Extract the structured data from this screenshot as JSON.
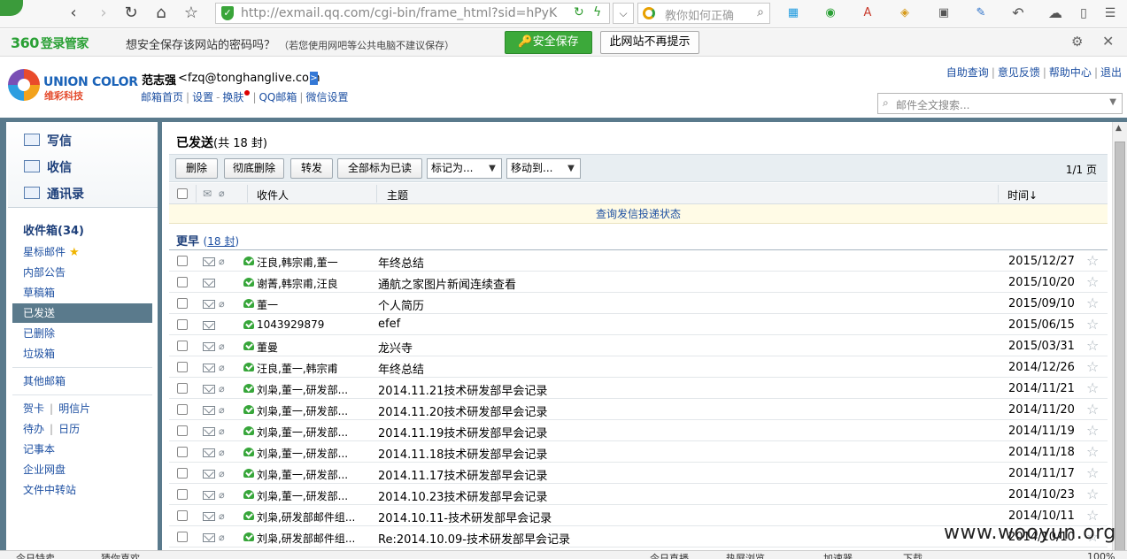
{
  "browser": {
    "url": "http://exmail.qq.com/cgi-bin/frame_html?sid=hPyK",
    "search_placeholder": "教你如何正确"
  },
  "password_bar": {
    "brand_360": "360",
    "brand_name": "登录管家",
    "message": "想安全保存该网站的密码吗？",
    "note": "（若您使用网吧等公共电脑不建议保存）",
    "save_label": "安全保存",
    "dont_ask_label": "此网站不再提示"
  },
  "header": {
    "logo_name": "UNION COLOR",
    "logo_sub": "维彩科技",
    "user_name": "范志强",
    "user_email": "<fzq@tonghanglive.com",
    "user_email_end": ">",
    "links": [
      "邮箱首页",
      "设置",
      "换肤",
      "QQ邮箱",
      "微信设置"
    ],
    "top_links": [
      "自助查询",
      "意见反馈",
      "帮助中心",
      "退出"
    ],
    "fulltext_placeholder": "邮件全文搜索..."
  },
  "sidebar": {
    "quick": [
      "写信",
      "收信",
      "通讯录"
    ],
    "folders": [
      {
        "label": "收件箱(34)",
        "bold": true
      },
      {
        "label": "星标邮件",
        "star": true
      },
      {
        "label": "内部公告"
      },
      {
        "label": "草稿箱"
      },
      {
        "label": "已发送",
        "selected": true
      },
      {
        "label": "已删除"
      },
      {
        "label": "垃圾箱"
      }
    ],
    "other": "其他邮箱",
    "tools": [
      {
        "a": "贺卡",
        "b": "明信片"
      },
      {
        "a": "待办",
        "b": "日历"
      }
    ],
    "extra": [
      "记事本",
      "企业网盘",
      "文件中转站"
    ]
  },
  "main": {
    "folder_title": "已发送",
    "folder_count": "(共 18 封)",
    "actions": [
      "删除",
      "彻底删除",
      "转发",
      "全部标为已读"
    ],
    "mark_as": "标记为...",
    "move_to": "移动到...",
    "pager": "1/1 页",
    "columns": {
      "to": "收件人",
      "subject": "主题",
      "time": "时间↓"
    },
    "track_link": "查询发信投递状态",
    "group_title": "更早",
    "group_count": "18 封",
    "rows": [
      {
        "to": "汪良,韩宗甫,董一",
        "subject": "年终总结",
        "date": "2015/12/27",
        "clip": true
      },
      {
        "to": "谢菁,韩宗甫,汪良",
        "subject": "通航之家图片新闻连续查看",
        "date": "2015/10/20",
        "clip": false
      },
      {
        "to": "董一",
        "subject": "个人简历",
        "date": "2015/09/10",
        "clip": true
      },
      {
        "to": "1043929879",
        "subject": "efef",
        "date": "2015/06/15",
        "clip": false
      },
      {
        "to": "董曼",
        "subject": "龙兴寺",
        "date": "2015/03/31",
        "clip": true
      },
      {
        "to": "汪良,董一,韩宗甫",
        "subject": "年终总结",
        "date": "2014/12/26",
        "clip": true
      },
      {
        "to": "刘枭,董一,研发部...",
        "subject": "2014.11.21技术研发部早会记录",
        "date": "2014/11/21",
        "clip": true
      },
      {
        "to": "刘枭,董一,研发部...",
        "subject": "2014.11.20技术研发部早会记录",
        "date": "2014/11/20",
        "clip": true
      },
      {
        "to": "刘枭,董一,研发部...",
        "subject": "2014.11.19技术研发部早会记录",
        "date": "2014/11/19",
        "clip": true
      },
      {
        "to": "刘枭,董一,研发部...",
        "subject": "2014.11.18技术研发部早会记录",
        "date": "2014/11/18",
        "clip": true
      },
      {
        "to": "刘枭,董一,研发部...",
        "subject": "2014.11.17技术研发部早会记录",
        "date": "2014/11/17",
        "clip": true
      },
      {
        "to": "刘枭,董一,研发部...",
        "subject": "2014.10.23技术研发部早会记录",
        "date": "2014/10/23",
        "clip": true
      },
      {
        "to": "刘枭,研发部邮件组...",
        "subject": "2014.10.11-技术研发部早会记录",
        "date": "2014/10/11",
        "clip": true
      },
      {
        "to": "刘枭,研发部邮件组...",
        "subject": "Re:2014.10.09-技术研发部早会记录",
        "date": "2014/10/10",
        "clip": true
      }
    ]
  },
  "statusbar": [
    "今日特卖",
    "猜你喜欢",
    "今日直播",
    "热屏浏览",
    "加速器",
    "下载",
    "100%"
  ],
  "watermark": "www.wooyun.org"
}
